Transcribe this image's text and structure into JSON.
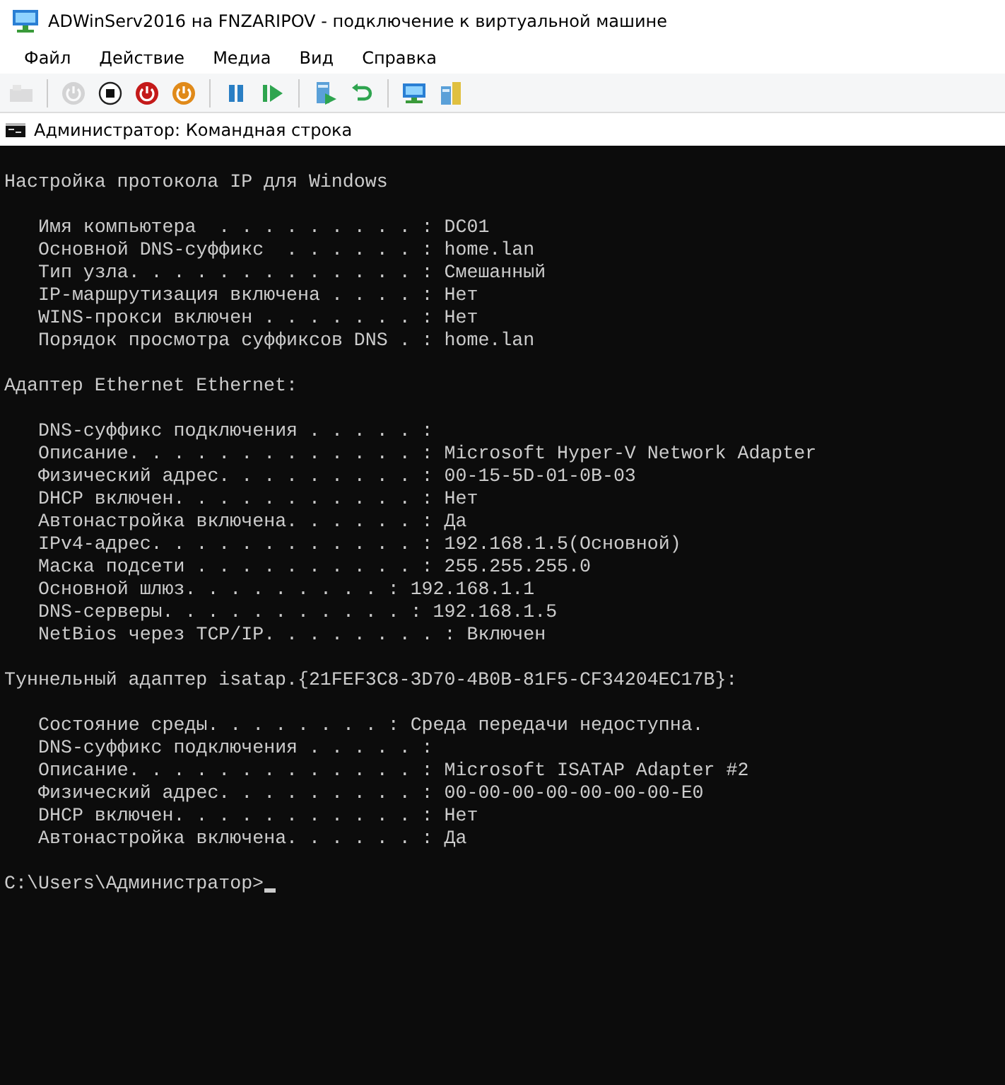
{
  "window": {
    "title": "ADWinServ2016 на FNZARIPOV - подключение к виртуальной машине"
  },
  "menu": [
    "Файл",
    "Действие",
    "Медиа",
    "Вид",
    "Справка"
  ],
  "toolbar_groups": [
    [
      {
        "kind": "ctrl-alt-del",
        "disabled": true
      }
    ],
    [
      {
        "kind": "start",
        "disabled": true
      },
      {
        "kind": "turn-off",
        "disabled": false
      },
      {
        "kind": "shut-down",
        "disabled": false
      },
      {
        "kind": "save",
        "disabled": false
      }
    ],
    [
      {
        "kind": "pause",
        "disabled": false
      },
      {
        "kind": "resume",
        "disabled": false
      }
    ],
    [
      {
        "kind": "checkpoint",
        "disabled": false
      },
      {
        "kind": "revert",
        "disabled": false
      }
    ],
    [
      {
        "kind": "basic-session",
        "disabled": false
      },
      {
        "kind": "enhanced-session",
        "disabled": false
      }
    ]
  ],
  "console": {
    "title": "Администратор: Командная строка",
    "sections": [
      {
        "heading": "Настройка протокола IP для Windows",
        "lines": [
          "Имя компьютера  . . . . . . . . . : DC01",
          "Основной DNS-суффикс  . . . . . . : home.lan",
          "Тип узла. . . . . . . . . . . . . : Смешанный",
          "IP-маршрутизация включена . . . . : Нет",
          "WINS-прокси включен . . . . . . . : Нет",
          "Порядок просмотра суффиксов DNS . : home.lan"
        ]
      },
      {
        "heading": "Адаптер Ethernet Ethernet:",
        "lines": [
          "DNS-суффикс подключения . . . . . :",
          "Описание. . . . . . . . . . . . . : Microsoft Hyper-V Network Adapter",
          "Физический адрес. . . . . . . . . : 00-15-5D-01-0B-03",
          "DHCP включен. . . . . . . . . . . : Нет",
          "Автонастройка включена. . . . . . : Да",
          "IPv4-адрес. . . . . . . . . . . . : 192.168.1.5(Основной)",
          "Маска подсети . . . . . . . . . . : 255.255.255.0",
          "Основной шлюз. . . . . . . . . : 192.168.1.1",
          "DNS-серверы. . . . . . . . . . . : 192.168.1.5",
          "NetBios через TCP/IP. . . . . . . . : Включен"
        ]
      },
      {
        "heading": "Туннельный адаптер isatap.{21FEF3C8-3D70-4B0B-81F5-CF34204EC17B}:",
        "lines": [
          "Состояние среды. . . . . . . . : Среда передачи недоступна.",
          "DNS-суффикс подключения . . . . . :",
          "Описание. . . . . . . . . . . . . : Microsoft ISATAP Adapter #2",
          "Физический адрес. . . . . . . . . : 00-00-00-00-00-00-00-E0",
          "DHCP включен. . . . . . . . . . . : Нет",
          "Автонастройка включена. . . . . . : Да"
        ]
      }
    ],
    "prompt": "C:\\Users\\Администратор>"
  }
}
